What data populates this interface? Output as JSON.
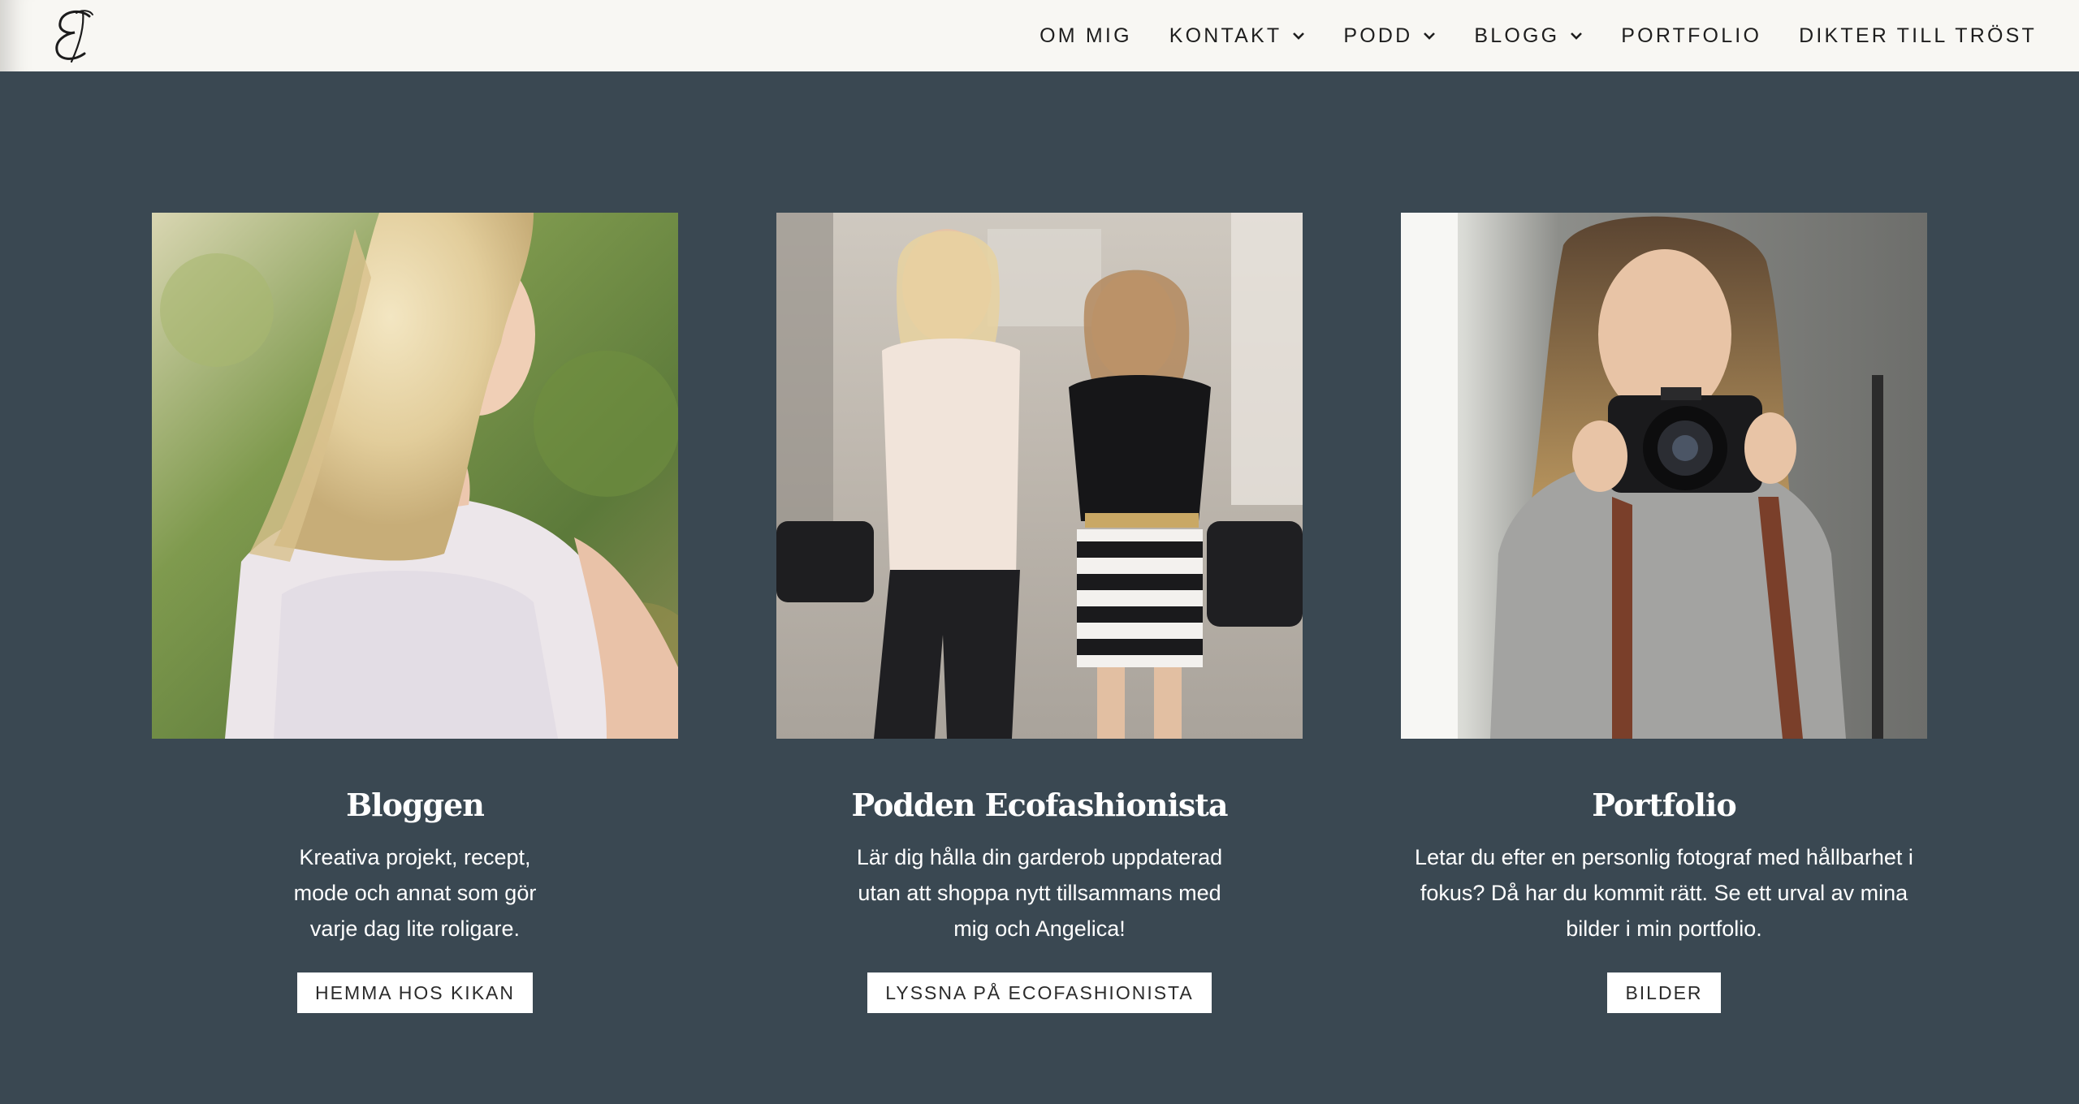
{
  "brand": {
    "logo_glyph": "𝓔",
    "icon": "script-e-logo"
  },
  "nav": {
    "items": [
      {
        "label": "OM MIG",
        "dropdown": false
      },
      {
        "label": "KONTAKT",
        "dropdown": true
      },
      {
        "label": "PODD",
        "dropdown": true
      },
      {
        "label": "BLOGG",
        "dropdown": true
      },
      {
        "label": "PORTFOLIO",
        "dropdown": false
      },
      {
        "label": "DIKTER TILL TRÖST",
        "dropdown": false
      }
    ]
  },
  "cards": [
    {
      "title": "Bloggen",
      "text": "Kreativa projekt, recept, mode och annat som gör varje dag lite roligare.",
      "button": "HEMMA HOS KIKAN",
      "image": "blonde-woman-lace-top-photo"
    },
    {
      "title": "Podden Ecofashionista",
      "text": "Lär dig hålla din garderob uppdaterad utan att shoppa nytt tillsammans med mig och Angelica!",
      "button": "LYSSNA PÅ ECOFASHIONISTA",
      "image": "two-women-walking-street-photo"
    },
    {
      "title": "Portfolio",
      "text": "Letar du efter en personlig fotograf med hållbarhet i fokus? Då har du kommit rätt. Se ett urval av mina bilder i min portfolio.",
      "button": "BILDER",
      "image": "woman-with-camera-photo"
    }
  ],
  "colors": {
    "background": "#3a4852",
    "header": "#f8f7f3",
    "text_light": "#ffffff",
    "button_bg": "#ffffff",
    "button_text": "#2b2b2b"
  }
}
